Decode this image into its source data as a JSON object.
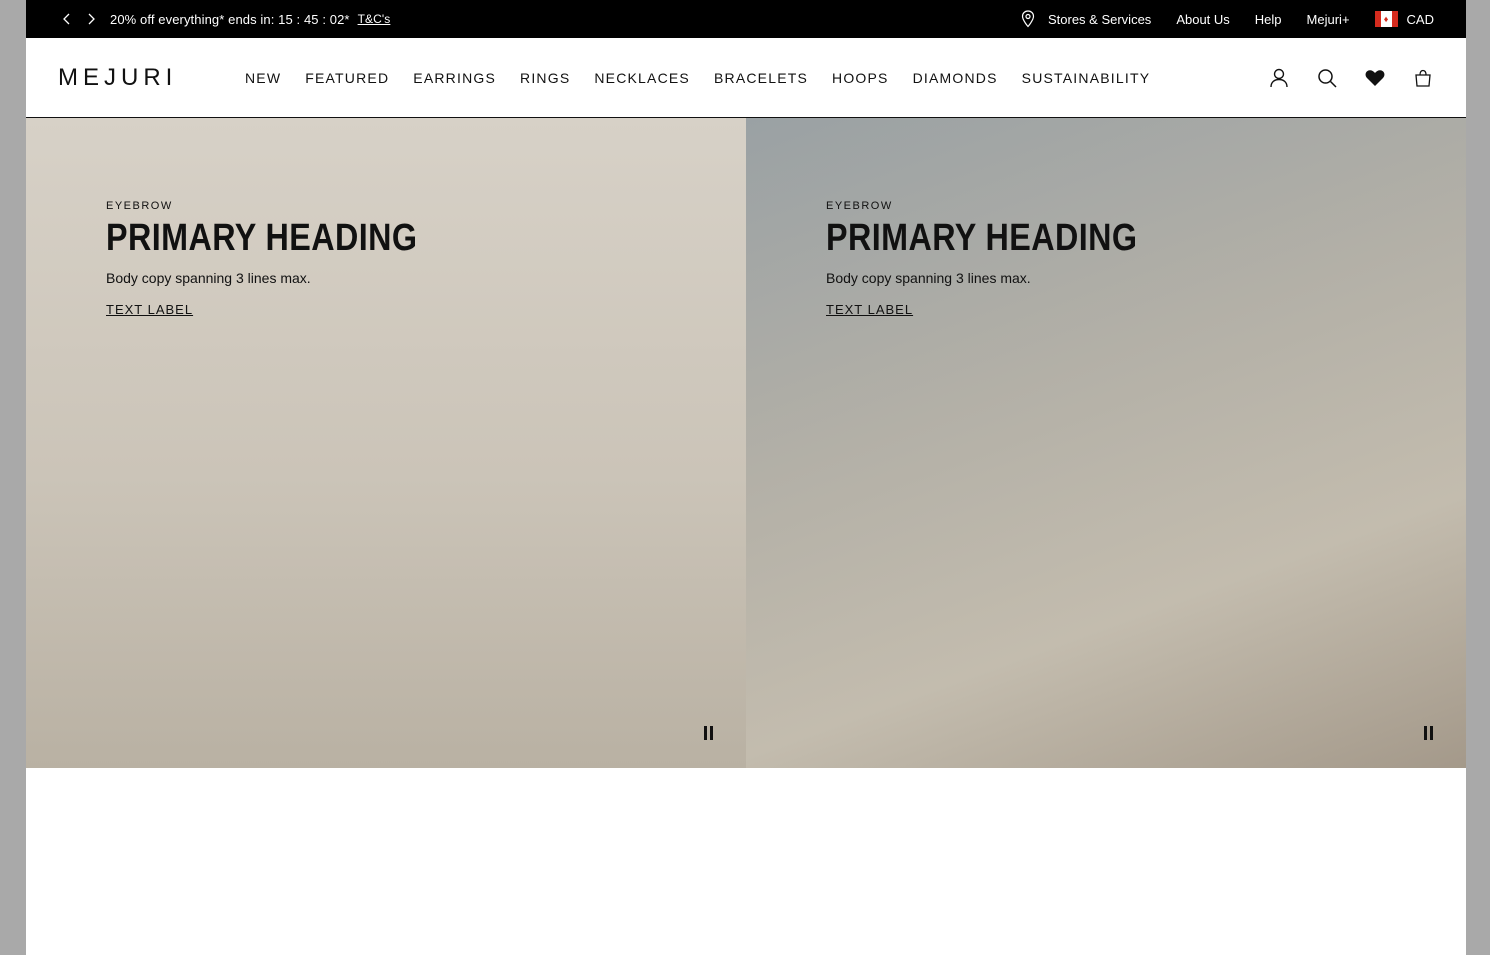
{
  "announcement": {
    "promo_text": "20% off everything* ends in: 15 : 45 : 02*",
    "terms_link": "T&C's",
    "links": [
      "Stores & Services",
      "About Us",
      "Help",
      "Mejuri+"
    ],
    "currency": "CAD"
  },
  "header": {
    "logo": "MEJURI",
    "nav": [
      "NEW",
      "FEATURED",
      "EARRINGS",
      "RINGS",
      "NECKLACES",
      "BRACELETS",
      "HOOPS",
      "DIAMONDS",
      "SUSTAINABILITY"
    ]
  },
  "hero": [
    {
      "eyebrow": "EYEBROW",
      "heading": "PRIMARY HEADING",
      "body": "Body copy spanning 3 lines max.",
      "cta": "TEXT LABEL"
    },
    {
      "eyebrow": "EYEBROW",
      "heading": "PRIMARY HEADING",
      "body": "Body copy spanning 3 lines max.",
      "cta": "TEXT LABEL"
    }
  ],
  "colors": {
    "announcement_bg": "#000000",
    "flag_red": "#d52b1e"
  }
}
